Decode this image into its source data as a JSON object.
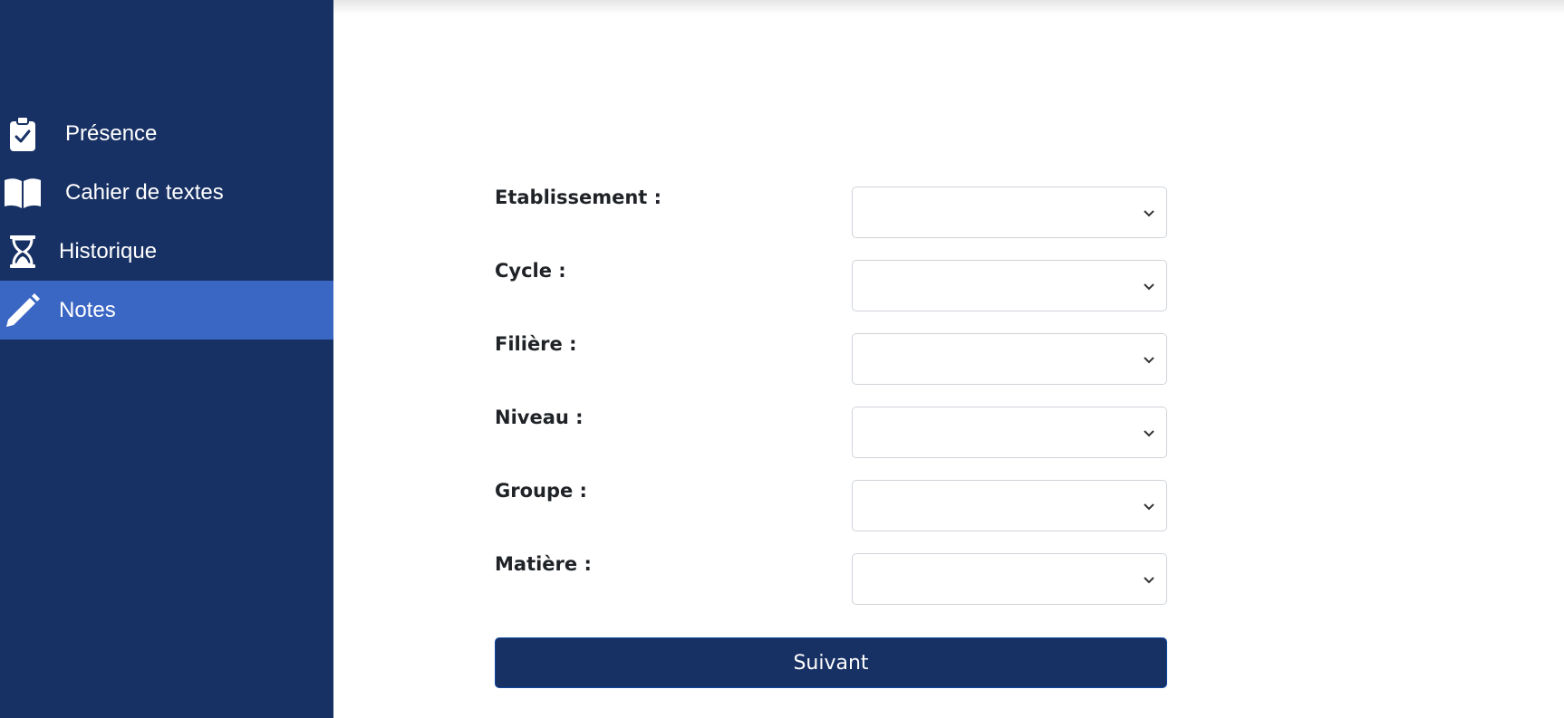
{
  "sidebar": {
    "items": [
      {
        "label": "Présence",
        "icon": "clipboard-check-icon",
        "active": false
      },
      {
        "label": "Cahier de textes",
        "icon": "book-open-icon",
        "active": false
      },
      {
        "label": "Historique",
        "icon": "hourglass-icon",
        "active": false
      },
      {
        "label": "Notes",
        "icon": "pencil-icon",
        "active": true
      }
    ]
  },
  "form": {
    "fields": [
      {
        "label": "Etablissement :",
        "value": ""
      },
      {
        "label": "Cycle :",
        "value": ""
      },
      {
        "label": "Filière :",
        "value": ""
      },
      {
        "label": "Niveau :",
        "value": ""
      },
      {
        "label": "Groupe :",
        "value": ""
      },
      {
        "label": "Matière :",
        "value": ""
      }
    ],
    "submit_label": "Suivant"
  },
  "colors": {
    "sidebar_bg": "#183164",
    "active_item_bg": "#3a66c4",
    "button_bg": "#183164"
  }
}
